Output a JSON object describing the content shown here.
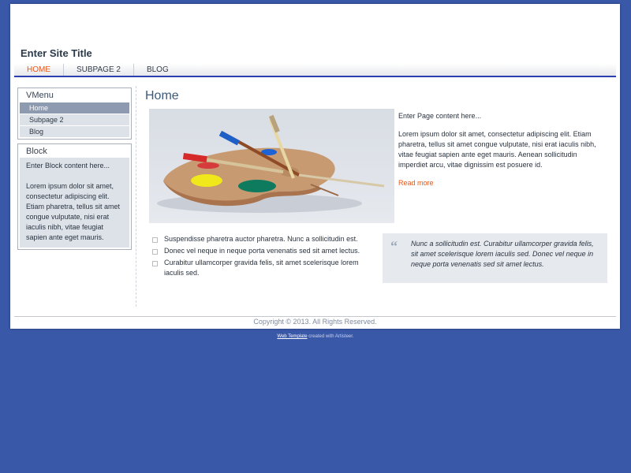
{
  "site": {
    "title": "Enter Site Title"
  },
  "nav": {
    "items": [
      {
        "label": "HOME"
      },
      {
        "label": "SUBPAGE 2"
      },
      {
        "label": "BLOG"
      }
    ]
  },
  "sidebar": {
    "vmenu": {
      "title": "VMenu",
      "items": [
        {
          "label": "Home"
        },
        {
          "label": "Subpage 2"
        },
        {
          "label": "Blog"
        }
      ]
    },
    "block": {
      "title": "Block",
      "intro": "Enter Block content here...",
      "body": "Lorem ipsum dolor sit amet, consectetur adipiscing elit. Etiam pharetra, tellus sit amet congue vulputate, nisi erat iaculis nibh, vitae feugiat sapien ante eget mauris."
    }
  },
  "main": {
    "heading": "Home",
    "intro": "Enter Page content here...",
    "paragraph": "Lorem ipsum dolor sit amet, consectetur adipiscing elit. Etiam pharetra, tellus sit amet congue vulputate, nisi erat iaculis nibh, vitae feugiat sapien ante eget mauris. Aenean sollicitudin imperdiet arcu, vitae dignissim est posuere id.",
    "read_more": "Read more",
    "bullets": [
      "Suspendisse pharetra auctor pharetra. Nunc a sollicitudin est.",
      "Donec vel neque in neque porta venenatis sed sit amet lectus.",
      "Curabitur ullamcorper gravida felis, sit amet scelerisque lorem iaculis sed."
    ],
    "quote": "Nunc a sollicitudin est. Curabitur ullamcorper gravida felis, sit amet scelerisque lorem iaculis sed. Donec vel neque in neque porta venenatis sed sit amet lectus."
  },
  "footer": {
    "copyright": "Copyright © 2013. All Rights Reserved."
  },
  "credit": {
    "link": "Web Template",
    "text": " created with Artisteer."
  },
  "colors": {
    "background": "#3a58a8",
    "accent": "#e8561a",
    "nav_border": "#2a3fb2"
  },
  "icons": {
    "quote": "quote-icon",
    "bullet": "bullet-icon"
  }
}
